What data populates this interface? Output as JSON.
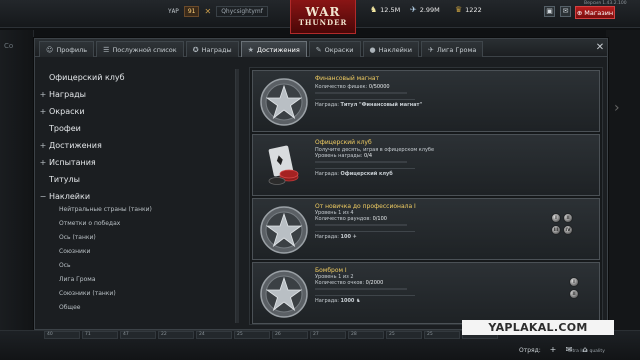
{
  "topbar": {
    "clan_tag": "YAP",
    "level": "91",
    "nickname": "Qhycsightymf",
    "logo_line1": "WAR",
    "logo_line2": "THUNDER",
    "silver_lions": "12.5M",
    "golden_eagles": "2.99M",
    "research_points": "1222",
    "shop_label": "Магазин",
    "version": "Версия 1.43.2.100"
  },
  "background": {
    "left_label": "Со"
  },
  "tabs": [
    {
      "label": "Профиль",
      "icon": "profile-icon"
    },
    {
      "label": "Послужной список",
      "icon": "list-icon"
    },
    {
      "label": "Награды",
      "icon": "medal-icon"
    },
    {
      "label": "Достижения",
      "icon": "star-icon",
      "active": true
    },
    {
      "label": "Окраски",
      "icon": "paint-icon"
    },
    {
      "label": "Наклейки",
      "icon": "sticker-icon"
    },
    {
      "label": "Лига Грома",
      "icon": "wing-icon"
    }
  ],
  "menu": {
    "items": [
      {
        "label": "Офицерский клуб",
        "prefix": ""
      },
      {
        "label": "Награды",
        "prefix": "+"
      },
      {
        "label": "Окраски",
        "prefix": "+"
      },
      {
        "label": "Трофеи",
        "prefix": ""
      },
      {
        "label": "Достижения",
        "prefix": "+"
      },
      {
        "label": "Испытания",
        "prefix": "+"
      },
      {
        "label": "Титулы",
        "prefix": ""
      },
      {
        "label": "Наклейки",
        "prefix": "−"
      }
    ],
    "subitems": [
      "Нейтральные страны (танки)",
      "Отметки о победах",
      "Ось (танки)",
      "Союзники",
      "Ось",
      "Лига Грома",
      "Союзники (танки)",
      "Общее"
    ]
  },
  "cards": [
    {
      "title": "Финансовый магнат",
      "line1_label": "Количество фишек:",
      "line1_value": "0/50000",
      "progress": 0,
      "reward_label": "Награда:",
      "reward_value": "Титул \"Финансовый магнат\""
    },
    {
      "title": "Офицерский клуб",
      "line1_label": "Получите десять, играя в офицерском клубе",
      "line2_label": "Уровень награды:",
      "line2_value": "0/4",
      "progress": 0,
      "reward_label": "Награда:",
      "reward_value": "Офицерский клуб"
    },
    {
      "title": "От новичка до профессионала I",
      "line1_label": "Уровень 1 из 4",
      "line2_label": "Количество раундов:",
      "line2_value": "0/100",
      "progress": 0,
      "reward_label": "Награда:",
      "reward_value": "100",
      "medal_levels": [
        "I",
        "II",
        "III",
        "IV"
      ]
    },
    {
      "title": "Бомбром I",
      "line1_label": "Уровень 1 из 2",
      "line2_label": "Количество очков:",
      "line2_value": "0/2000",
      "progress": 0,
      "reward_label": "Награда:",
      "reward_value": "1000",
      "medal_levels": [
        "I",
        "II"
      ]
    }
  ],
  "bottombar": {
    "slots": [
      "40",
      "71",
      "47",
      "22",
      "24",
      "25",
      "26",
      "27",
      "28",
      "25",
      "25",
      "25"
    ],
    "squad_label": "Отряд:",
    "quality": "Ultra low quality"
  },
  "watermark": "YAPLAKAL.COM",
  "colors": {
    "accent_gold": "#f1cd62",
    "shop_red": "#b81c1c",
    "panel": "#1b1e21"
  }
}
